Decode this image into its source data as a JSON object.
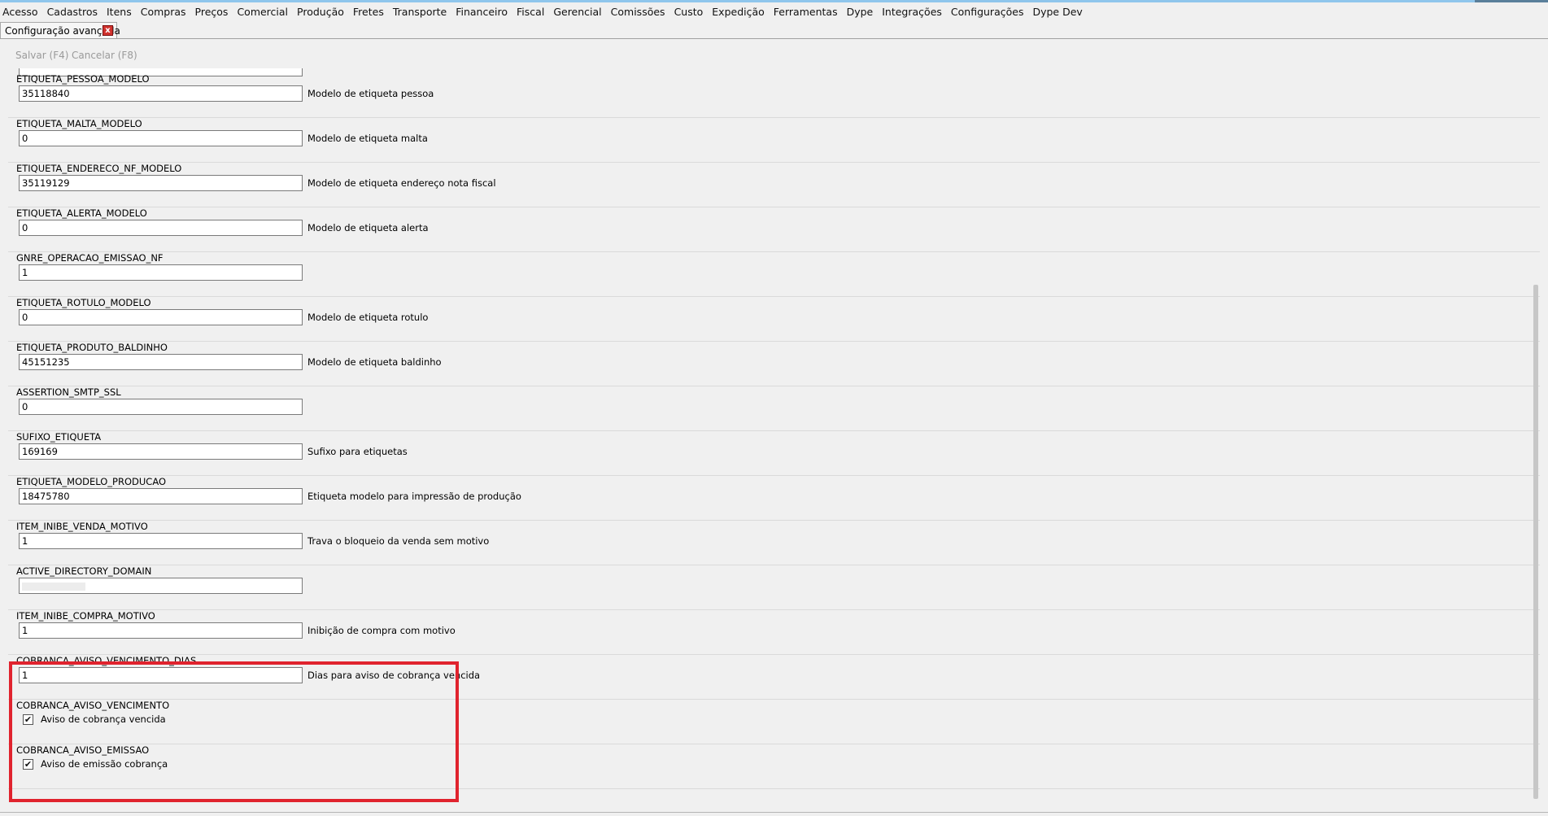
{
  "menu": [
    "Acesso",
    "Cadastros",
    "Itens",
    "Compras",
    "Preços",
    "Comercial",
    "Produção",
    "Fretes",
    "Transporte",
    "Financeiro",
    "Fiscal",
    "Gerencial",
    "Comissões",
    "Custo",
    "Expedição",
    "Ferramentas",
    "Dype",
    "Integrações",
    "Configurações",
    "Dype Dev"
  ],
  "tab": {
    "label": "Configuração avançada",
    "close": "x"
  },
  "toolbar": {
    "save": "Salvar (F4)",
    "cancel": "Cancelar (F8)"
  },
  "rows": [
    {
      "key": "ETIQUETA_PESSOA_MODELO",
      "type": "text",
      "value": "35118840",
      "desc": "Modelo de etiqueta pessoa"
    },
    {
      "key": "ETIQUETA_MALTA_MODELO",
      "type": "text",
      "value": "0",
      "desc": "Modelo de etiqueta malta"
    },
    {
      "key": "ETIQUETA_ENDERECO_NF_MODELO",
      "type": "text",
      "value": "35119129",
      "desc": "Modelo de etiqueta endereço nota fiscal"
    },
    {
      "key": "ETIQUETA_ALERTA_MODELO",
      "type": "text",
      "value": "0",
      "desc": "Modelo de etiqueta alerta"
    },
    {
      "key": "GNRE_OPERACAO_EMISSAO_NF",
      "type": "text",
      "value": "1",
      "desc": ""
    },
    {
      "key": "ETIQUETA_ROTULO_MODELO",
      "type": "text",
      "value": "0",
      "desc": "Modelo de etiqueta rotulo"
    },
    {
      "key": "ETIQUETA_PRODUTO_BALDINHO",
      "type": "text",
      "value": "45151235",
      "desc": "Modelo de etiqueta baldinho"
    },
    {
      "key": "ASSERTION_SMTP_SSL",
      "type": "text",
      "value": "0",
      "desc": ""
    },
    {
      "key": "SUFIXO_ETIQUETA",
      "type": "text",
      "value": "169169",
      "desc": "Sufixo para etiquetas"
    },
    {
      "key": "ETIQUETA_MODELO_PRODUCAO",
      "type": "text",
      "value": "18475780",
      "desc": "Etiqueta modelo para impressão de produção"
    },
    {
      "key": "ITEM_INIBE_VENDA_MOTIVO",
      "type": "text",
      "value": "1",
      "desc": "Trava o bloqueio da venda sem motivo"
    },
    {
      "key": "ACTIVE_DIRECTORY_DOMAIN",
      "type": "text",
      "value": "",
      "desc": ""
    },
    {
      "key": "ITEM_INIBE_COMPRA_MOTIVO",
      "type": "text",
      "value": "1",
      "desc": "Inibição de compra com motivo"
    },
    {
      "key": "COBRANCA_AVISO_VENCIMENTO_DIAS",
      "type": "text",
      "value": "1",
      "desc": "Dias para aviso de cobrança vencida"
    },
    {
      "key": "COBRANCA_AVISO_VENCIMENTO",
      "type": "checkbox",
      "checked": true,
      "desc": "Aviso de cobrança vencida"
    },
    {
      "key": "COBRANCA_AVISO_EMISSAO",
      "type": "checkbox",
      "checked": true,
      "desc": "Aviso de emissão cobrança"
    }
  ],
  "colors": {
    "highlight": "#e0232e",
    "close_button": "#d0312d"
  },
  "icons": {
    "checkmark": "checkmark-icon",
    "close": "close-icon"
  }
}
